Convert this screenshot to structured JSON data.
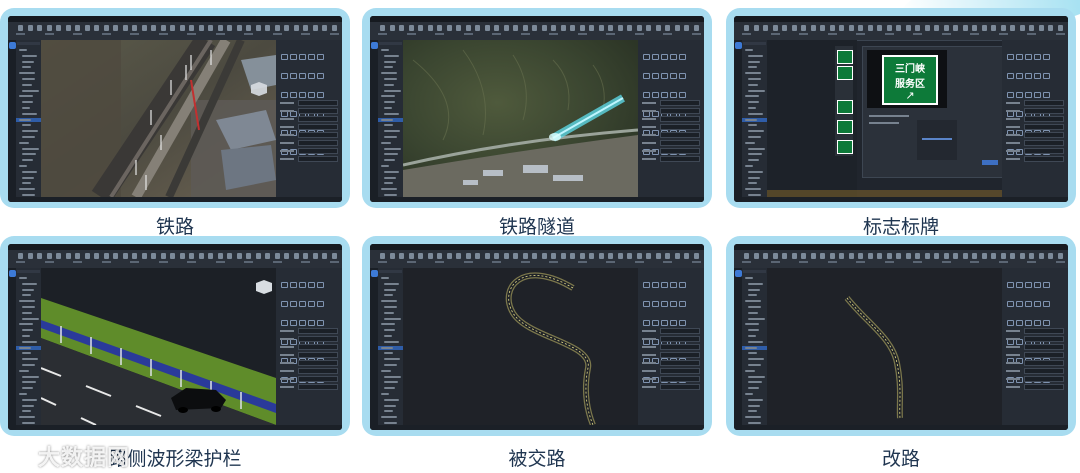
{
  "captions": [
    "铁路",
    "铁路隧道",
    "标志标牌",
    "路侧波形梁护栏",
    "被交路",
    "改路"
  ],
  "sign": {
    "line1": "三门峡",
    "line2": "服务区",
    "arrow": "↗"
  },
  "watermark": {
    "text": "大数据网",
    "icon": "loop-logo-icon"
  },
  "colors": {
    "card_border": "#a8dcf0",
    "caption": "#1f3550",
    "app_bg": "#20252d",
    "panel_bg": "#262c35",
    "selection": "#2f5da8",
    "sign_green": "#0d7a39",
    "road_line": "#c9c06a",
    "tunnel": "#5fe0f0",
    "guardrail_blue": "#2a3a9a",
    "grass": "#5f8c2a"
  },
  "icons": [
    "app-logo-icon",
    "toolbar-icon",
    "tree-expand-icon",
    "tool-grid-icon",
    "axis-gizmo-icon"
  ]
}
